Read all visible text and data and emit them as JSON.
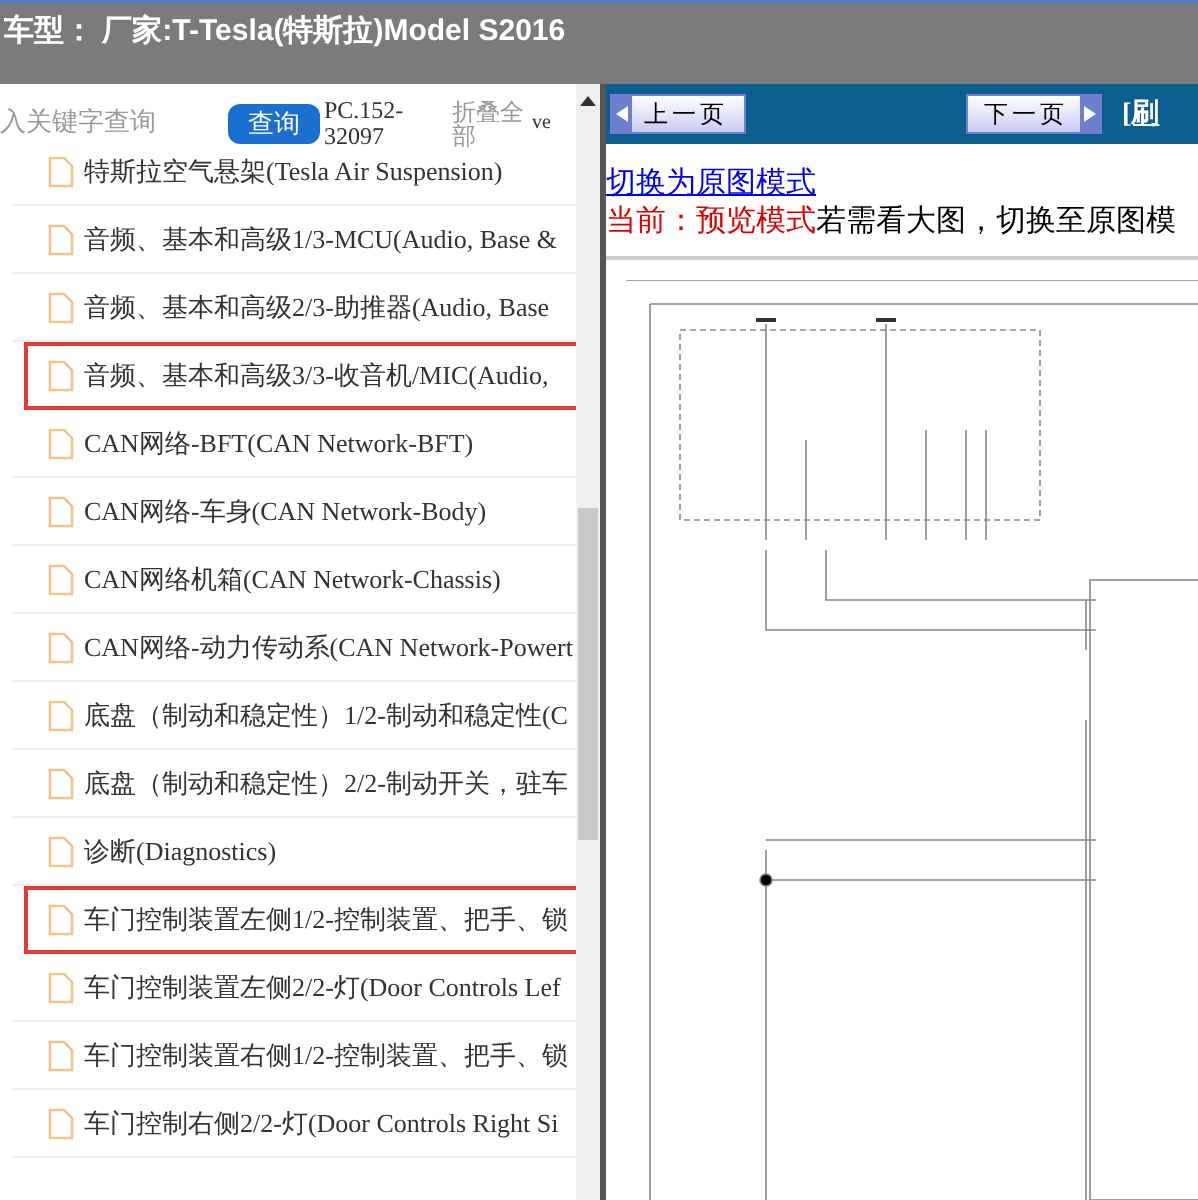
{
  "header": {
    "title": "车型： 厂家:T-Tesla(特斯拉)Model S2016"
  },
  "toolbar": {
    "search": {
      "placeholder": "入关键字查询"
    },
    "search_button": "查询",
    "code": "PC.152-32097",
    "collapse": "折叠全部",
    "column_5": "ve"
  },
  "tree": {
    "items": [
      {
        "label": "特斯拉空气悬架(Tesla Air Suspension)",
        "selected": false
      },
      {
        "label": "音频、基本和高级1/3-MCU(Audio, Base &",
        "selected": false
      },
      {
        "label": "音频、基本和高级2/3-助推器(Audio, Base",
        "selected": false
      },
      {
        "label": "音频、基本和高级3/3-收音机/MIC(Audio,",
        "selected": true
      },
      {
        "label": "CAN网络-BFT(CAN Network-BFT)",
        "selected": false
      },
      {
        "label": "CAN网络-车身(CAN Network-Body)",
        "selected": false
      },
      {
        "label": "CAN网络机箱(CAN Network-Chassis)",
        "selected": false
      },
      {
        "label": "CAN网络-动力传动系(CAN Network-Powert",
        "selected": false
      },
      {
        "label": "底盘（制动和稳定性）1/2-制动和稳定性(C",
        "selected": false
      },
      {
        "label": "底盘（制动和稳定性）2/2-制动开关，驻车",
        "selected": false
      },
      {
        "label": "诊断(Diagnostics)",
        "selected": false
      },
      {
        "label": "车门控制装置左侧1/2-控制装置、把手、锁",
        "selected": true
      },
      {
        "label": "车门控制装置左侧2/2-灯(Door Controls Lef",
        "selected": false
      },
      {
        "label": "车门控制装置右侧1/2-控制装置、把手、锁",
        "selected": false
      },
      {
        "label": "车门控制右侧2/2-灯(Door Controls Right Si",
        "selected": false
      }
    ]
  },
  "viewer": {
    "prev_button": "上一页",
    "next_button": "下一页",
    "refresh": "[刷",
    "mode_link": "切换为原图模式",
    "notice": {
      "current": "当前：预览模式",
      "hint": "若需看大图，切换至原图模"
    }
  }
}
